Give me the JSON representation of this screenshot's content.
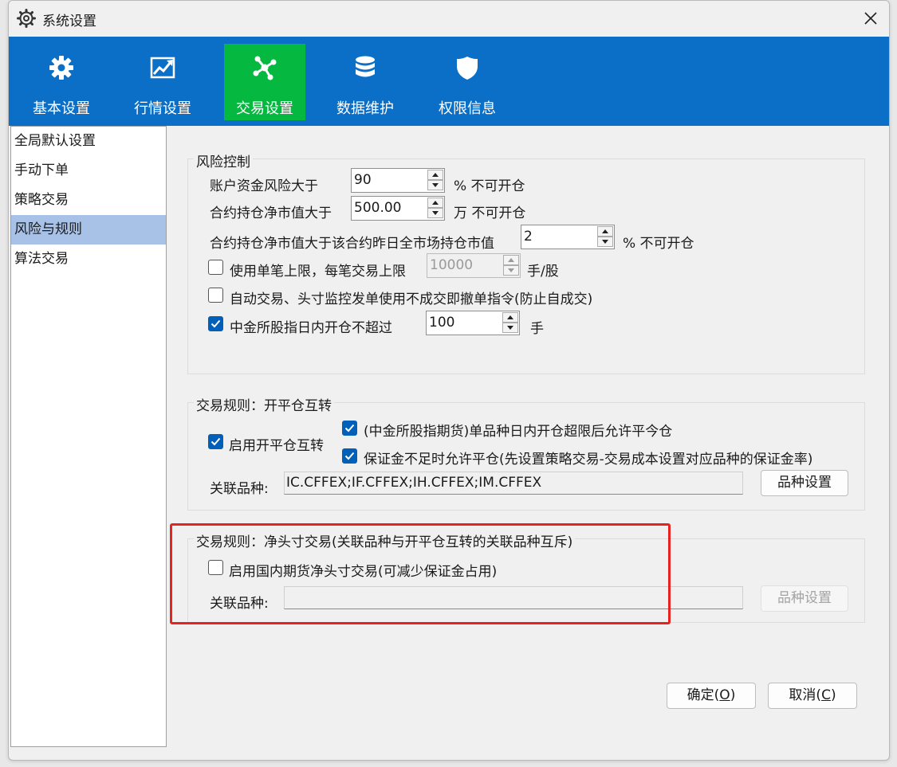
{
  "window": {
    "title": "系统设置"
  },
  "toolbar": {
    "items": [
      {
        "label": "基本设置",
        "icon": "gear-icon"
      },
      {
        "label": "行情设置",
        "icon": "chart-icon"
      },
      {
        "label": "交易设置",
        "icon": "network-icon",
        "active": true
      },
      {
        "label": "数据维护",
        "icon": "database-icon"
      },
      {
        "label": "权限信息",
        "icon": "shield-icon"
      }
    ],
    "active_color": "#05b83f",
    "bar_color": "#0b6fc7"
  },
  "sidebar": {
    "items": [
      {
        "label": "全局默认设置"
      },
      {
        "label": "手动下单"
      },
      {
        "label": "策略交易"
      },
      {
        "label": "风险与规则",
        "selected": true
      },
      {
        "label": "算法交易"
      }
    ]
  },
  "risk": {
    "title": "风险控制",
    "account_risk": {
      "label": "账户资金风险大于",
      "value": "90",
      "suffix": "%  不可开仓"
    },
    "net_value": {
      "label": "合约持仓净市值大于",
      "value": "500.00",
      "suffix": "万 不可开仓"
    },
    "market_value": {
      "label": "合约持仓净市值大于该合约昨日全市场持仓市值",
      "value": "2",
      "suffix": "%  不可开仓"
    },
    "single_limit": {
      "label": "使用单笔上限，每笔交易上限",
      "value": "10000",
      "suffix": "手/股",
      "checked": false
    },
    "auto_trade": {
      "label": "自动交易、头寸监控发单使用不成交即撤单指令(防止自成交)",
      "checked": false
    },
    "cffex_limit": {
      "label": "中金所股指日内开仓不超过",
      "value": "100",
      "suffix": "手",
      "checked": true
    }
  },
  "rule_open_close": {
    "title": "交易规则：开平仓互转",
    "enable": {
      "label": "启用开平仓互转",
      "checked": true
    },
    "opt1": {
      "label": "(中金所股指期货)单品种日内开仓超限后允许平今仓",
      "checked": true
    },
    "opt2": {
      "label": "保证金不足时允许平仓(先设置策略交易-交易成本设置对应品种的保证金率)",
      "checked": true
    },
    "related_label": "关联品种:",
    "related_value": "IC.CFFEX;IF.CFFEX;IH.CFFEX;IM.CFFEX",
    "button": "品种设置"
  },
  "rule_net": {
    "title": "交易规则：净头寸交易(关联品种与开平仓互转的关联品种互斥)",
    "enable": {
      "label": "启用国内期货净头寸交易(可减少保证金占用)",
      "checked": false
    },
    "related_label": "关联品种:",
    "related_value": "",
    "button": "品种设置"
  },
  "footer": {
    "ok": {
      "text": "确定(",
      "key": "O",
      "end": ")"
    },
    "cancel": {
      "text": "取消(",
      "key": "C",
      "end": ")"
    }
  }
}
